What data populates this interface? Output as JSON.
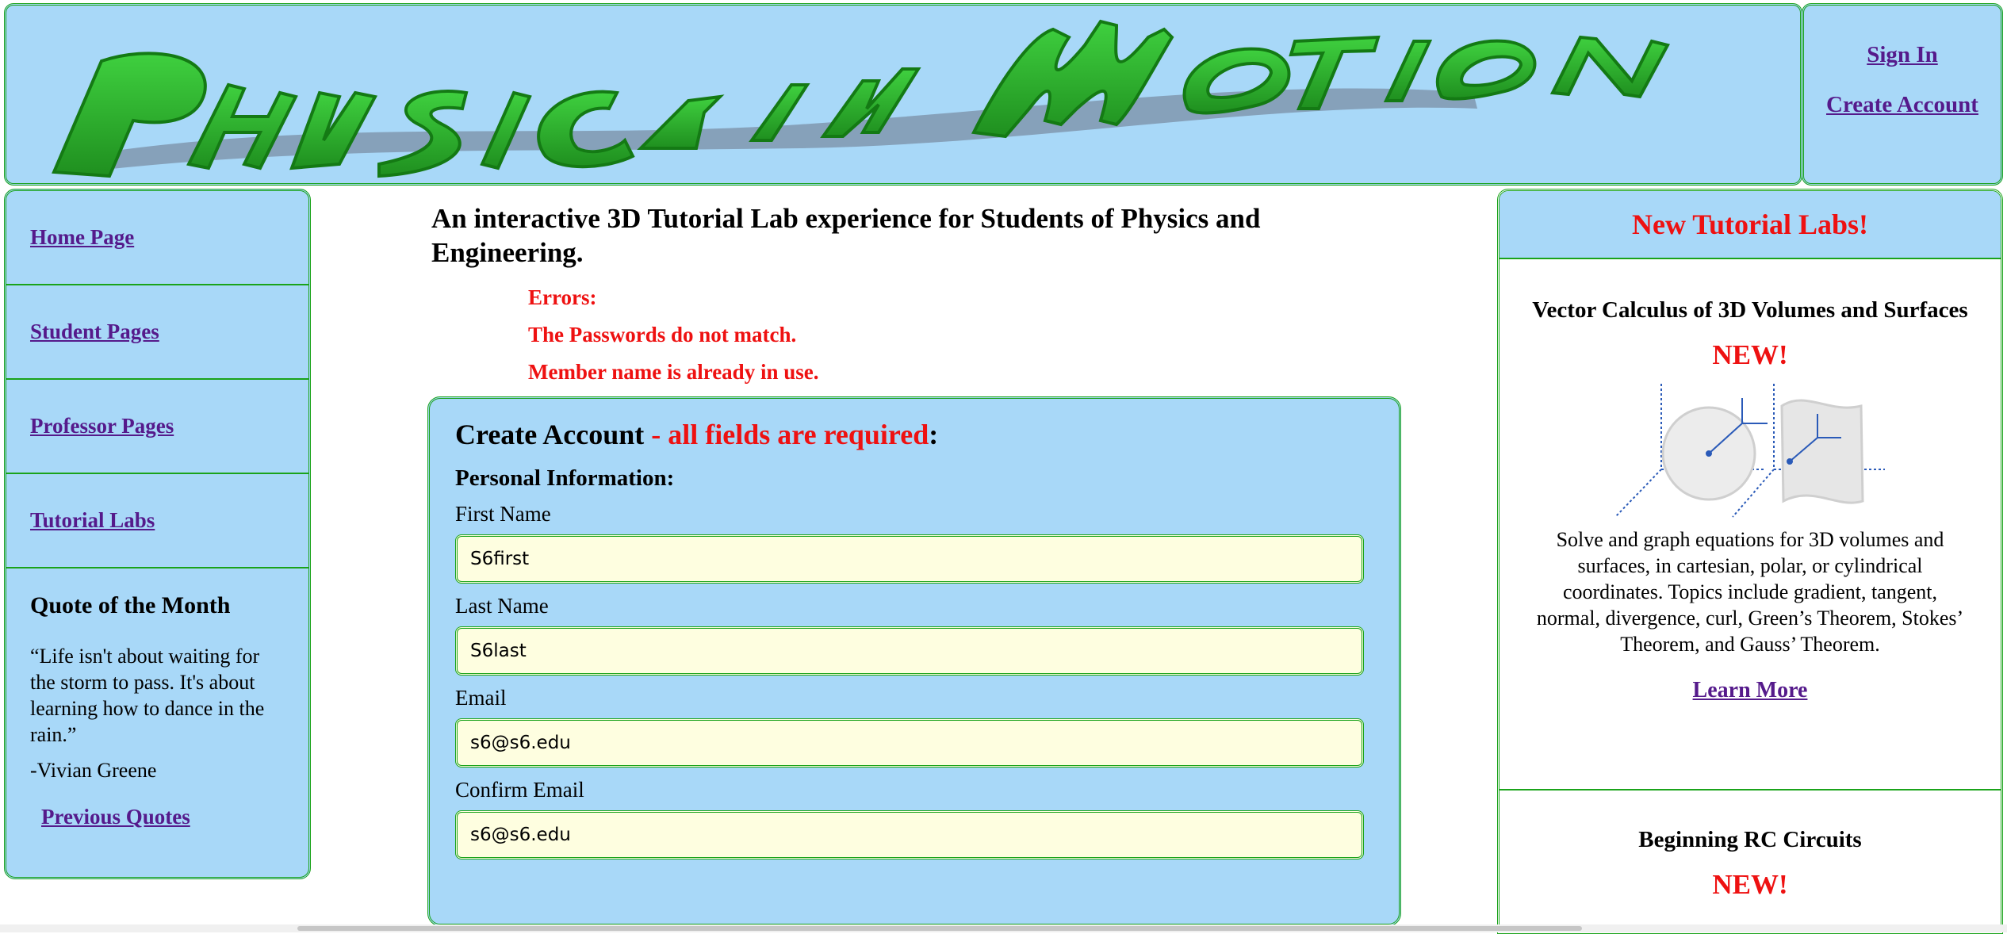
{
  "header": {
    "logo_text": "Physics in Motion"
  },
  "account": {
    "sign_in": "Sign In",
    "create_account": "Create Account"
  },
  "sidebar": {
    "items": [
      {
        "label": "Home Page"
      },
      {
        "label": "Student Pages"
      },
      {
        "label": "Professor Pages"
      },
      {
        "label": "Tutorial Labs"
      }
    ],
    "quote": {
      "heading": "Quote of the Month",
      "text": "“Life isn't about waiting for the storm to pass. It's about learning how to dance in the rain.”",
      "author": "-Vivian Greene",
      "previous_link": "Previous Quotes"
    }
  },
  "main": {
    "tagline": "An interactive 3D Tutorial Lab experience for Students of Physics and Engineering.",
    "errors": {
      "heading": "Errors:",
      "items": [
        "The Passwords do not match.",
        "Member name is already in use."
      ]
    },
    "form": {
      "title": "Create Account",
      "title_required": " - all fields are required",
      "title_colon": ":",
      "section": "Personal Information:",
      "fields": [
        {
          "label": "First Name",
          "value": "S6first"
        },
        {
          "label": "Last Name",
          "value": "S6last"
        },
        {
          "label": "Email",
          "value": "s6@s6.edu"
        },
        {
          "label": "Confirm Email",
          "value": "s6@s6.edu"
        }
      ]
    }
  },
  "right": {
    "header": "New Tutorial Labs!",
    "tutorials": [
      {
        "title": "Vector Calculus of 3D Volumes and Surfaces",
        "badge": "NEW!",
        "description": "Solve and graph equations for 3D volumes and surfaces, in cartesian, polar, or cylindrical coordinates. Topics include gradient, tangent, normal, divergence, curl, Green’s Theorem, Stokes’ Theorem, and Gauss’ Theorem.",
        "link": "Learn More"
      },
      {
        "title": "Beginning RC Circuits",
        "badge": "NEW!"
      }
    ]
  },
  "colors": {
    "panel_bg": "#a8d8f8",
    "border_green": "#1aa31a",
    "logo_green": "#2fb52f",
    "error_red": "#ee1111",
    "input_bg": "#fefee0",
    "link": "#551a8b"
  }
}
